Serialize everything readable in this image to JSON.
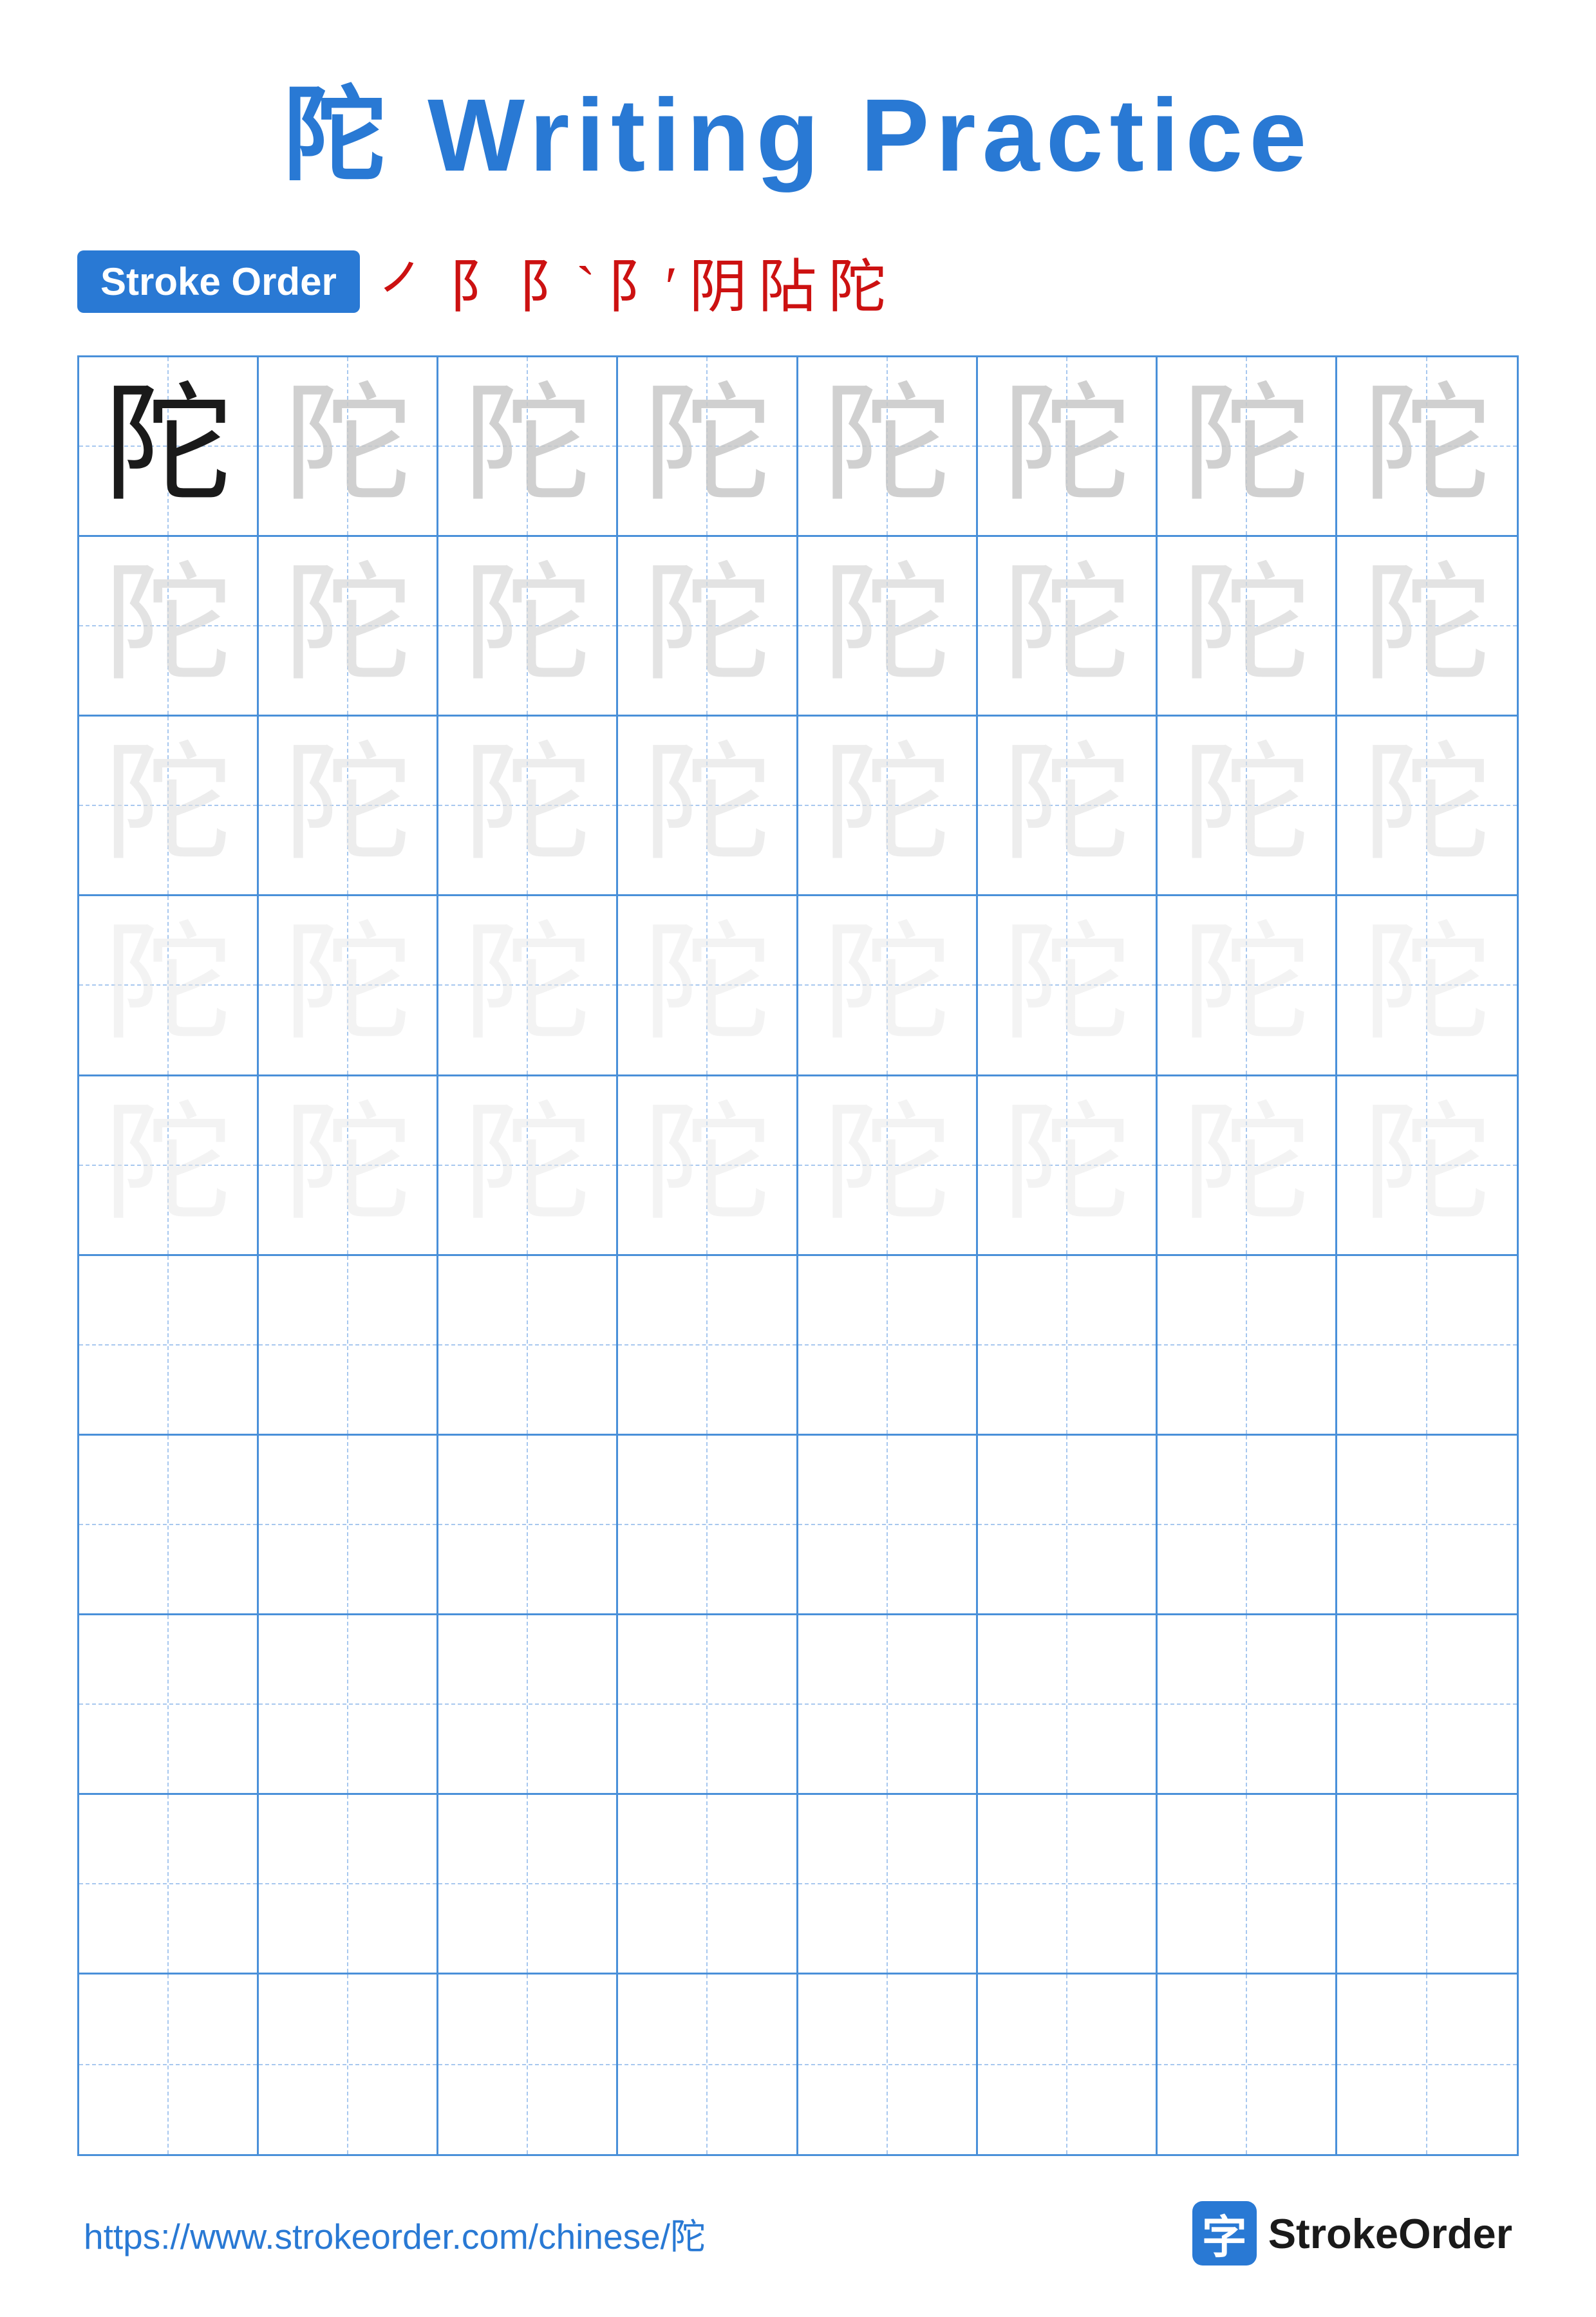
{
  "title": {
    "chinese": "陀",
    "english": " Writing Practice"
  },
  "stroke_order": {
    "badge_label": "Stroke Order",
    "strokes": [
      "㇒",
      "㔿",
      "㔿`",
      "㔿′",
      "阝⺄",
      "阽",
      "陀"
    ]
  },
  "grid": {
    "rows": 10,
    "cols": 8,
    "char": "陀",
    "practice_rows": 5,
    "empty_rows": 5
  },
  "footer": {
    "url": "https://www.strokeorder.com/chinese/陀",
    "logo_char": "字",
    "logo_text": "StrokeOrder"
  }
}
